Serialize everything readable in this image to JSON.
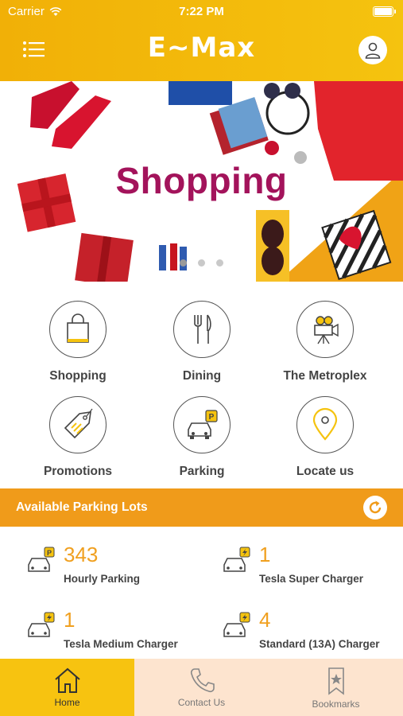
{
  "status": {
    "carrier": "Carrier",
    "time": "7:22 PM"
  },
  "header": {
    "brand": "E~Max"
  },
  "banner": {
    "title": "Shopping",
    "dots": 3,
    "active_dot": 0
  },
  "grid": [
    {
      "label": "Shopping"
    },
    {
      "label": "Dining"
    },
    {
      "label": "The Metroplex"
    },
    {
      "label": "Promotions"
    },
    {
      "label": "Parking"
    },
    {
      "label": "Locate us"
    }
  ],
  "parking": {
    "title": "Available Parking Lots",
    "lots": [
      {
        "count": "343",
        "name": "Hourly Parking"
      },
      {
        "count": "1",
        "name": "Tesla Super Charger"
      },
      {
        "count": "1",
        "name": "Tesla Medium Charger"
      },
      {
        "count": "4",
        "name": "Standard (13A) Charger"
      }
    ]
  },
  "tabs": [
    {
      "label": "Home",
      "active": true
    },
    {
      "label": "Contact Us",
      "active": false
    },
    {
      "label": "Bookmarks",
      "active": false
    }
  ],
  "colors": {
    "accent": "#f5c30f",
    "orange": "#f09b1a",
    "brand_magenta": "#a3135b"
  }
}
